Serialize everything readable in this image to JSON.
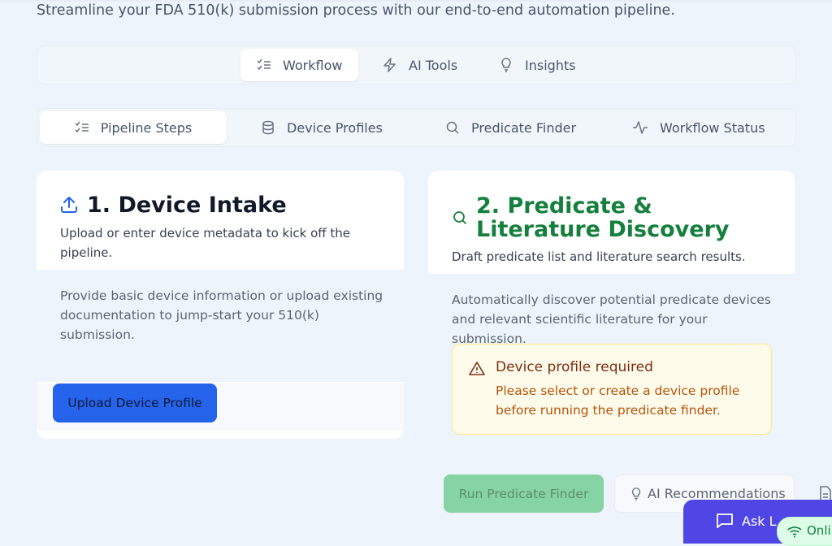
{
  "header": {
    "subtitle": "Streamline your FDA 510(k) submission process with our end-to-end automation pipeline."
  },
  "main_tabs": [
    {
      "label": "Workflow",
      "icon": "list-checks-icon",
      "active": true
    },
    {
      "label": "AI Tools",
      "icon": "zap-icon",
      "active": false
    },
    {
      "label": "Insights",
      "icon": "lightbulb-icon",
      "active": false
    }
  ],
  "sub_tabs": [
    {
      "label": "Pipeline Steps",
      "icon": "list-checks-icon",
      "active": true
    },
    {
      "label": "Device Profiles",
      "icon": "database-icon",
      "active": false
    },
    {
      "label": "Predicate Finder",
      "icon": "search-icon",
      "active": false
    },
    {
      "label": "Workflow Status",
      "icon": "activity-icon",
      "active": false
    }
  ],
  "intake": {
    "title": "1. Device Intake",
    "subtitle": "Upload or enter device metadata to kick off the pipeline.",
    "description": "Provide basic device information or upload existing documentation to jump-start your 510(k) submission.",
    "button": "Upload Device Profile"
  },
  "predicate": {
    "title": "2. Predicate & Literature Discovery",
    "subtitle": "Draft predicate list and literature search results.",
    "description": "Automatically discover potential predicate devices and relevant scientific literature for your submission.",
    "alert_title": "Device profile required",
    "alert_text": "Please select or create a device profile before running the predicate finder.",
    "run_button": "Run Predicate Finder",
    "recommend_button": "AI Recommendations"
  },
  "chat": {
    "label": "Ask L",
    "status": "Onli"
  },
  "colors": {
    "primary": "#2563eb",
    "success": "#15803d",
    "warning": "#b45309",
    "chat": "#4f46e5"
  }
}
